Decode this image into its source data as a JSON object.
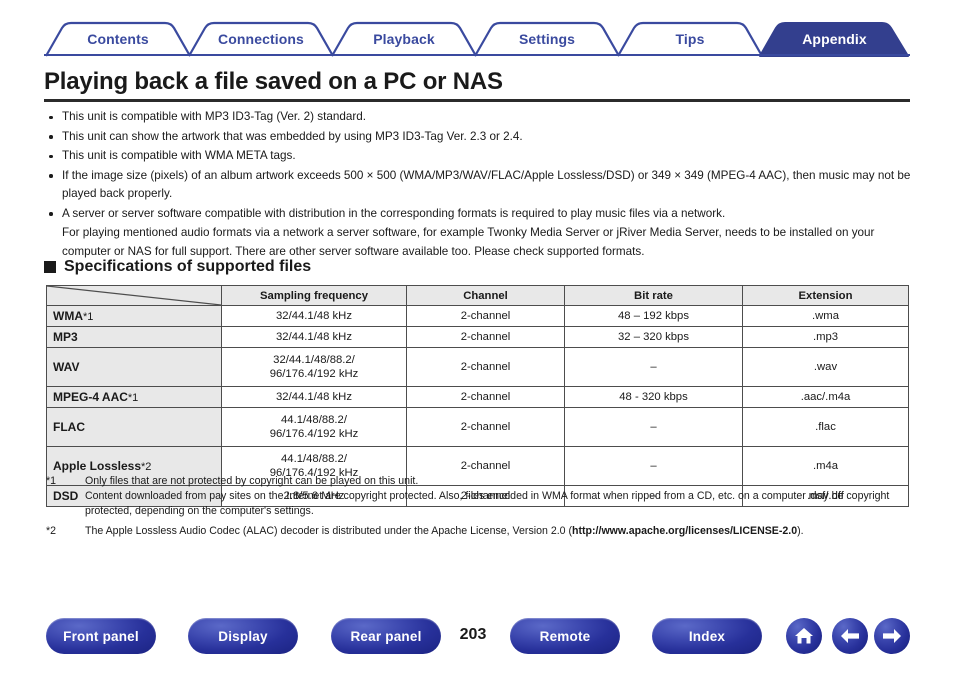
{
  "tabs": [
    {
      "label": "Contents",
      "active": false
    },
    {
      "label": "Connections",
      "active": false
    },
    {
      "label": "Playback",
      "active": false
    },
    {
      "label": "Settings",
      "active": false
    },
    {
      "label": "Tips",
      "active": false
    },
    {
      "label": "Appendix",
      "active": true
    }
  ],
  "page": {
    "title": "Playing back a file saved on a PC or NAS",
    "page_number": "203"
  },
  "bullets": [
    "This unit is compatible with MP3 ID3-Tag (Ver. 2) standard.",
    "This unit can show the artwork that was embedded by using MP3 ID3-Tag Ver. 2.3 or 2.4.",
    "This unit is compatible with WMA META tags.",
    "If the image size (pixels) of an album artwork exceeds 500 × 500 (WMA/MP3/WAV/FLAC/Apple Lossless/DSD) or 349 × 349 (MPEG-4 AAC), then music may not be played back properly.",
    "A server or server software compatible with distribution in the corresponding formats is required to play music files via a network."
  ],
  "sub_paragraph": "For playing mentioned audio formats via a network a server software, for example Twonky Media Server or jRiver Media Server, needs to be installed on your computer or NAS for full support. There are other server software available too. Please check supported formats.",
  "section": {
    "heading": "Specifications of supported files"
  },
  "table": {
    "headers": [
      "",
      "Sampling frequency",
      "Channel",
      "Bit rate",
      "Extension"
    ],
    "rows": [
      {
        "format": "WMA",
        "format_note": "*1",
        "sampling": "32/44.1/48 kHz",
        "channel": "2-channel",
        "bitrate": "48 – 192 kbps",
        "extension": ".wma",
        "tall": false
      },
      {
        "format": "MP3",
        "format_note": "",
        "sampling": "32/44.1/48 kHz",
        "channel": "2-channel",
        "bitrate": "32 – 320 kbps",
        "extension": ".mp3",
        "tall": false
      },
      {
        "format": "WAV",
        "format_note": "",
        "sampling": "32/44.1/48/88.2/\n96/176.4/192 kHz",
        "channel": "2-channel",
        "bitrate": "–",
        "extension": ".wav",
        "tall": true
      },
      {
        "format": "MPEG-4 AAC",
        "format_note": "*1",
        "sampling": "32/44.1/48 kHz",
        "channel": "2-channel",
        "bitrate": "48 - 320 kbps",
        "extension": ".aac/.m4a",
        "tall": false
      },
      {
        "format": "FLAC",
        "format_note": "",
        "sampling": "44.1/48/88.2/\n96/176.4/192 kHz",
        "channel": "2-channel",
        "bitrate": "–",
        "extension": ".flac",
        "tall": true
      },
      {
        "format": "Apple Lossless",
        "format_note": "*2",
        "sampling": "44.1/48/88.2/\n96/176.4/192 kHz",
        "channel": "2-channel",
        "bitrate": "–",
        "extension": ".m4a",
        "tall": true
      },
      {
        "format": "DSD",
        "format_note": "",
        "sampling": "2.8/5.6 MHz",
        "channel": "2-channel",
        "bitrate": "–",
        "extension": ".dsf/.dff",
        "tall": false
      }
    ]
  },
  "footnotes": [
    {
      "mark": "*1",
      "line1": "Only files that are not protected by copyright can be played on this unit.",
      "line2": "Content downloaded from pay sites on the Internet are copyright protected. Also, files encoded in WMA format when ripped from a CD, etc. on a computer may be copyright protected, depending on the computer's settings."
    },
    {
      "mark": "*2",
      "line1_pre": "The Apple Lossless Audio Codec (ALAC) decoder is distributed under the Apache License, Version 2.0 (",
      "link": "http://www.apache.org/licenses/LICENSE-2.0",
      "line1_post": ")."
    }
  ],
  "footer": {
    "buttons": [
      {
        "label": "Front panel"
      },
      {
        "label": "Display"
      },
      {
        "label": "Rear panel"
      },
      {
        "label": "Remote"
      },
      {
        "label": "Index"
      }
    ],
    "icons": [
      {
        "name": "home-icon"
      },
      {
        "name": "arrow-left-icon"
      },
      {
        "name": "arrow-right-icon"
      }
    ]
  },
  "colors": {
    "brand_blue": "#3a4a9f",
    "active_tab": "#333f8e",
    "table_header_bg": "#e8e8e8",
    "text": "#1a1a1a"
  }
}
